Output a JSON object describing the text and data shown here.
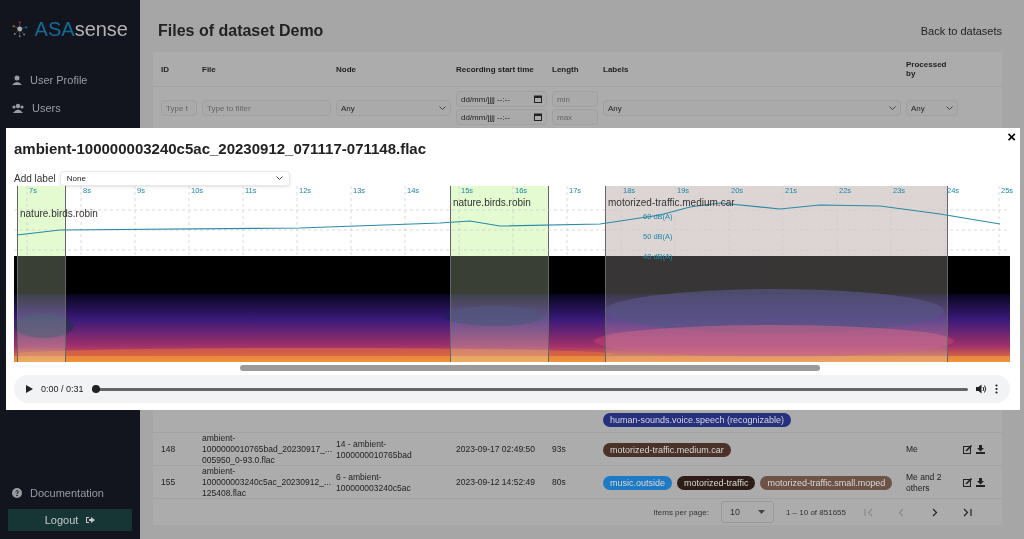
{
  "sidebar": {
    "logo": {
      "brand_a": "ASA",
      "brand_b": "sense"
    },
    "items": [
      {
        "label": "User Profile"
      },
      {
        "label": "Users"
      }
    ],
    "bottom_items": [
      {
        "label": "Documentation"
      }
    ],
    "logout": "Logout"
  },
  "page": {
    "title": "Files of dataset Demo",
    "back_link": "Back to datasets"
  },
  "table": {
    "columns": [
      "ID",
      "File",
      "Node",
      "Recording start time",
      "Length",
      "Labels",
      "Processed by"
    ],
    "filters": {
      "id_placeholder": "Type t",
      "file_placeholder": "Type to filter",
      "node": "Any",
      "date_from": "dd/mm/jjjj --:--",
      "date_to": "dd/mm/jjjj --:--",
      "length_min": "min",
      "length_max": "max",
      "labels": "Any",
      "processed_by": "Any"
    },
    "rows": [
      {
        "labels": [
          {
            "text": "human-sounds.voice.speech (recognizable)",
            "color": "#25307f"
          }
        ]
      },
      {
        "id": "148",
        "file": [
          "ambient-",
          "1000000010765bad_20230917_...",
          "005950_0-93.0.flac"
        ],
        "node": [
          "14 - ambient-",
          "1000000010765bad"
        ],
        "start": "2023-09-17 02:49:50",
        "length": "93s",
        "labels": [
          {
            "text": "motorized-traffic.medium.car",
            "color": "#4a3228"
          }
        ],
        "processed_by": "Me"
      },
      {
        "id": "155",
        "file": [
          "ambient-",
          "100000003240c5ac_20230912_...",
          "125408.flac"
        ],
        "node": [
          "6 - ambient-",
          "100000003240c5ac"
        ],
        "start": "2023-09-12 14:52:49",
        "length": "80s",
        "labels": [
          {
            "text": "music.outside",
            "color": "#1f7ac4"
          },
          {
            "text": "motorized-traffic",
            "color": "#2e1d17"
          },
          {
            "text": "motorized-traffic.small.moped",
            "color": "#6d5246"
          }
        ],
        "processed_by": "Me and 2 others"
      }
    ],
    "pagination": {
      "items_label": "Items per page:",
      "page_size": "10",
      "range": "1 – 10 of 851655",
      "first_disabled": true,
      "prev_disabled": true,
      "next_disabled": false,
      "last_disabled": false
    }
  },
  "dialog": {
    "title": "ambient-100000003240c5ac_20230912_071117-071148.flac",
    "close": "×",
    "add_label": "Add label",
    "add_label_value": "None",
    "time_ticks": [
      "7s",
      "8s",
      "9s",
      "10s",
      "11s",
      "12s",
      "13s",
      "14s",
      "15s",
      "16s",
      "17s",
      "18s",
      "19s",
      "20s",
      "21s",
      "22s",
      "23s",
      "24s",
      "25s"
    ],
    "db_ticks": [
      "60 dB(A)",
      "50 dB(A)",
      "40 dB(A)"
    ],
    "regions": [
      {
        "label": "nature.birds.robin",
        "color": "#e4fbd2"
      },
      {
        "label": "nature.birds.robin",
        "color": "#e4fbd2"
      },
      {
        "label": "motorized-traffic.medium.car",
        "color": "#ddd5d3"
      }
    ],
    "player": {
      "time": "0:00 / 0:31",
      "level": 0
    }
  }
}
